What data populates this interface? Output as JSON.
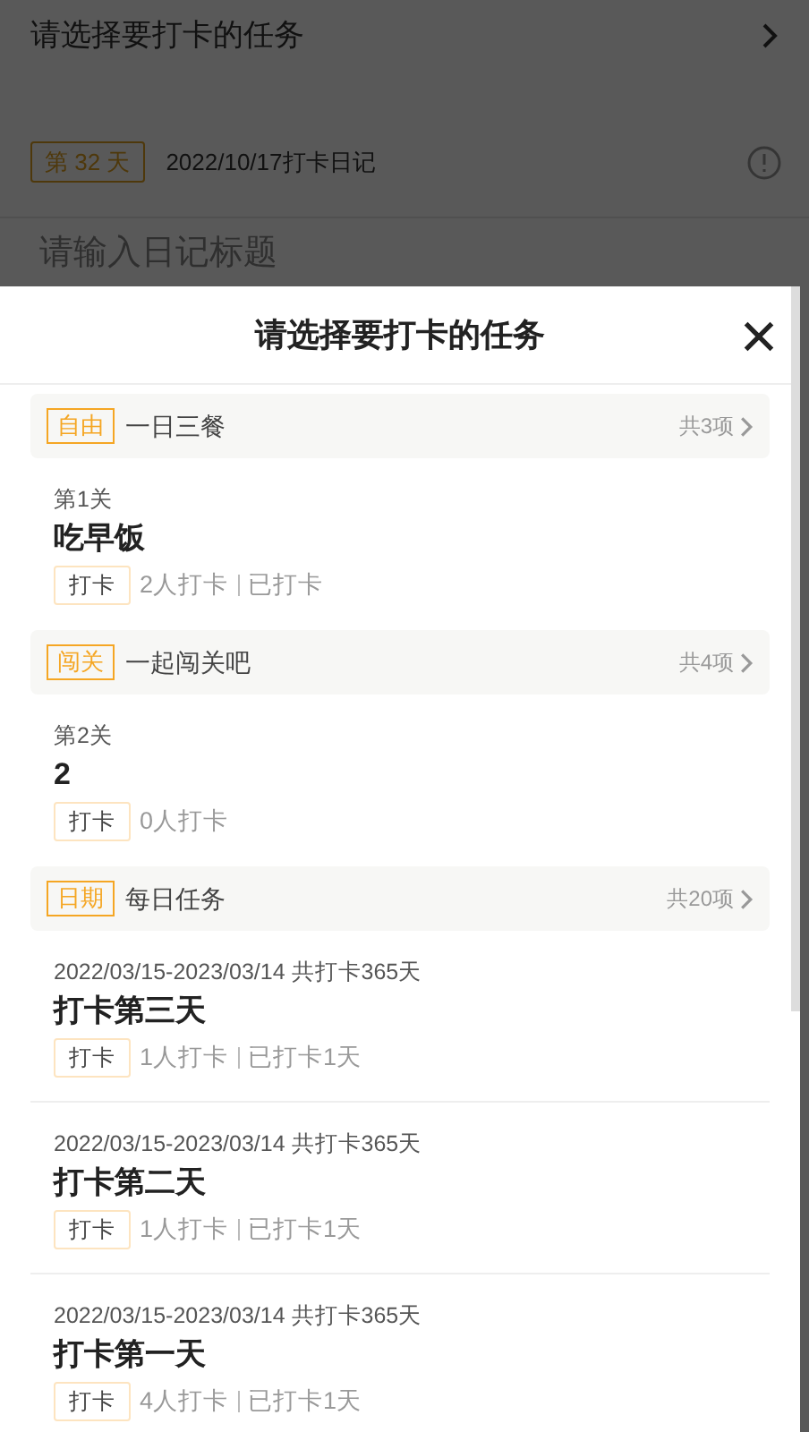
{
  "background": {
    "task_picker": {
      "label": "请选择要打卡的任务"
    },
    "diary": {
      "day_tag": "第 32 天",
      "date_title": "2022/10/17打卡日记"
    },
    "title_field": {
      "placeholder": "请输入日记标题"
    }
  },
  "sheet": {
    "title": "请选择要打卡的任务",
    "groups": [
      {
        "tag": "自由",
        "name": "一日三餐",
        "count": "共3项",
        "items": [
          {
            "subtitle": "第1关",
            "title": "吃早饭",
            "button": "打卡",
            "stats": [
              "2人打卡",
              "已打卡"
            ]
          }
        ]
      },
      {
        "tag": "闯关",
        "name": "一起闯关吧",
        "count": "共4项",
        "items": [
          {
            "subtitle": "第2关",
            "title": "2",
            "button": "打卡",
            "stats": [
              "0人打卡"
            ]
          }
        ]
      },
      {
        "tag": "日期",
        "name": "每日任务",
        "count": "共20项",
        "items": [
          {
            "subtitle": "2022/03/15-2023/03/14 共打卡365天",
            "title": "打卡第三天",
            "button": "打卡",
            "stats": [
              "1人打卡",
              "已打卡1天"
            ]
          },
          {
            "subtitle": "2022/03/15-2023/03/14 共打卡365天",
            "title": "打卡第二天",
            "button": "打卡",
            "stats": [
              "1人打卡",
              "已打卡1天"
            ]
          },
          {
            "subtitle": "2022/03/15-2023/03/14 共打卡365天",
            "title": "打卡第一天",
            "button": "打卡",
            "stats": [
              "4人打卡",
              "已打卡1天"
            ]
          }
        ]
      }
    ]
  }
}
